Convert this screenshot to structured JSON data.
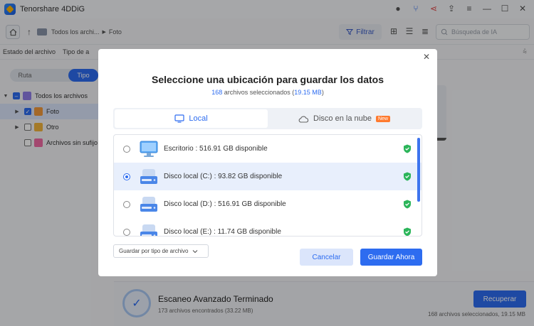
{
  "app": {
    "title": "Tenorshare 4DDiG"
  },
  "toolbar": {
    "breadcrumb": [
      "Todos los archi...",
      "Foto"
    ],
    "filter_label": "Filtrar",
    "ai_search_placeholder": "Búsqueda de IA"
  },
  "filterbar": {
    "items": [
      "Estado del archivo",
      "Tipo de a"
    ]
  },
  "sidebar": {
    "tabs": [
      "Ruta",
      "Tipo"
    ],
    "active_tab": "Tipo",
    "tree": [
      {
        "label": "Todos los archivos",
        "checked": "partial",
        "expanded": true
      },
      {
        "label": "Foto",
        "checked": true,
        "selected": true
      },
      {
        "label": "Otro",
        "checked": false
      },
      {
        "label": "Archivos sin sufijo",
        "checked": false
      }
    ]
  },
  "status": {
    "scan_title": "Escaneo Avanzado Terminado",
    "scan_sub": "173 archivos encontrados (33.22 MB)",
    "recover_label": "Recuperar",
    "selected_summary": "168 archivos seleccionados, 19.15 MB"
  },
  "dialog": {
    "title": "Seleccione una ubicación para guardar los datos",
    "subtitle_count": "168",
    "subtitle_text": " archivos seleccionados (",
    "subtitle_size": "19.15 MB",
    "subtitle_end": ")",
    "tabs": {
      "local": "Local",
      "cloud": "Disco en la nube",
      "cloud_badge": "New"
    },
    "drives": [
      {
        "label": "Escritorio  : 516.91 GB disponible",
        "type": "desktop",
        "selected": false
      },
      {
        "label": "Disco local (C:) : 93.82 GB disponible",
        "type": "disk",
        "selected": true
      },
      {
        "label": "Disco local (D:) : 516.91 GB disponible",
        "type": "disk",
        "selected": false
      },
      {
        "label": "Disco local (E:) : 11.74 GB disponible",
        "type": "disk",
        "selected": false
      }
    ],
    "save_type_label": "Guardar por tipo de archivo",
    "cancel_label": "Cancelar",
    "save_label": "Guardar Ahora"
  },
  "colors": {
    "accent": "#2d6cf0",
    "shield": "#2cb55a"
  }
}
